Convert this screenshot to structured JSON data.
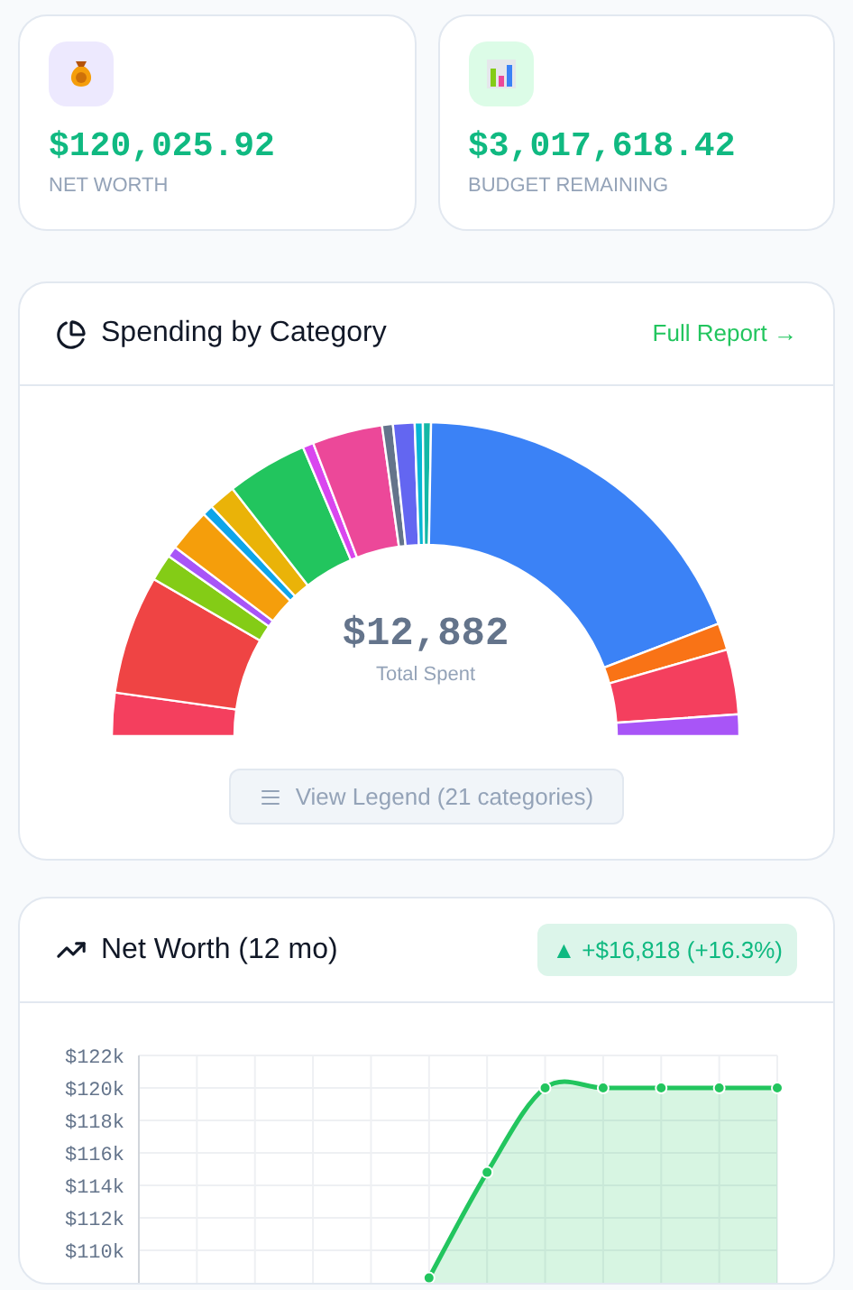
{
  "stats": [
    {
      "kind": "money-bag",
      "value": "$120,025.92",
      "label": "NET WORTH"
    },
    {
      "kind": "bar-chart",
      "value": "$3,017,618.42",
      "label": "BUDGET REMAINING"
    }
  ],
  "spending": {
    "title": "Spending by Category",
    "link": "Full Report →",
    "total": "$12,882",
    "total_label": "Total Spent",
    "legend_button": "View Legend (21 categories)"
  },
  "net_worth": {
    "title": "Net Worth (12 mo)",
    "change": "▲ +$16,818 (+16.3%)",
    "chart_data": {
      "type": "area",
      "grid": true,
      "ylim": [
        108,
        122
      ],
      "yticks": [
        {
          "value": 110,
          "label": "$110k"
        },
        {
          "value": 112,
          "label": "$112k"
        },
        {
          "value": 114,
          "label": "$114k"
        },
        {
          "value": 116,
          "label": "$116k"
        },
        {
          "value": 118,
          "label": "$118k"
        },
        {
          "value": 120,
          "label": "$120k"
        },
        {
          "value": 122,
          "label": "$122k"
        }
      ],
      "series": [
        {
          "color": "#22c55e",
          "values": [
            null,
            null,
            null,
            null,
            null,
            108.3,
            114.8,
            120,
            120,
            120,
            120,
            120
          ]
        }
      ]
    }
  }
}
